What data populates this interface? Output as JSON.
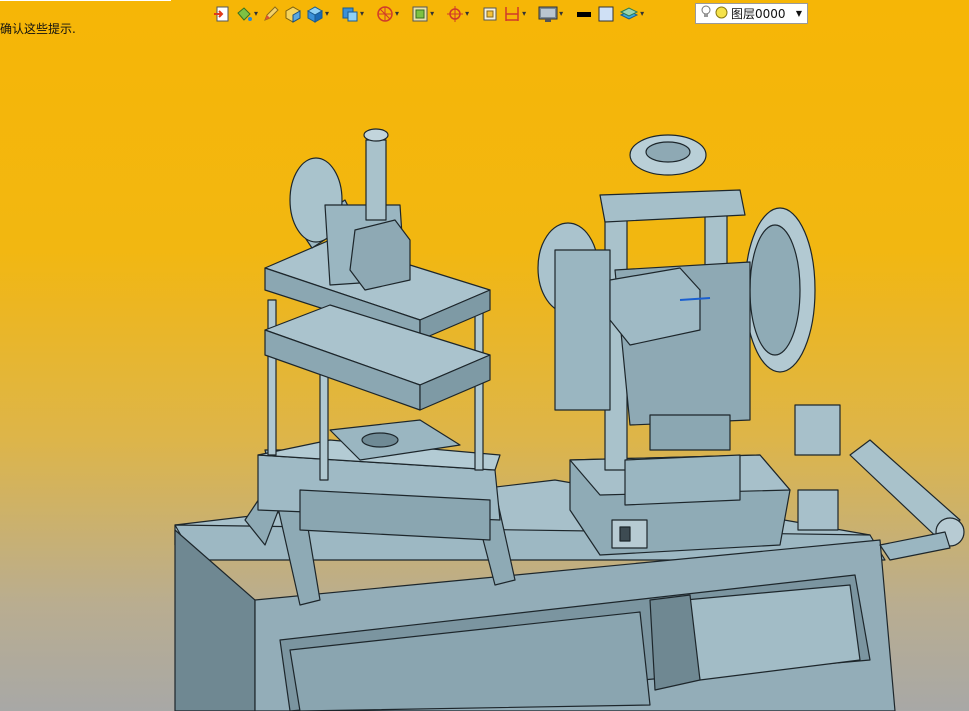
{
  "hint": {
    "text": "确认这些提示."
  },
  "toolbar": {
    "buttons": [
      {
        "icon": "import-icon",
        "dropdown": false
      },
      {
        "icon": "paint-bucket-icon",
        "dropdown": true
      },
      {
        "icon": "pen-icon",
        "dropdown": false
      },
      {
        "icon": "box-icon",
        "dropdown": false
      },
      {
        "icon": "solid-cube-icon",
        "dropdown": true
      },
      {
        "icon": "view-cube-icon",
        "dropdown": true
      },
      {
        "icon": "section-icon",
        "dropdown": true
      },
      {
        "icon": "frame-icon",
        "dropdown": true
      },
      {
        "icon": "target-icon",
        "dropdown": true
      },
      {
        "icon": "box-select-icon",
        "dropdown": false
      },
      {
        "icon": "dimension-icon",
        "dropdown": true
      },
      {
        "icon": "monitor-icon",
        "dropdown": true
      },
      {
        "icon": "line-weight-icon",
        "dropdown": false
      },
      {
        "icon": "color-swatch-icon",
        "dropdown": false
      },
      {
        "icon": "layers-icon",
        "dropdown": true
      }
    ]
  },
  "layer": {
    "current": "图层0000"
  },
  "colors": {
    "model": "#9ab6c2",
    "model_dark": "#6e8a96",
    "outline": "#202a30",
    "accent_blue": "#1a5fd0",
    "bg_top": "#f6b606",
    "bg_bottom": "#a8a8a6"
  }
}
